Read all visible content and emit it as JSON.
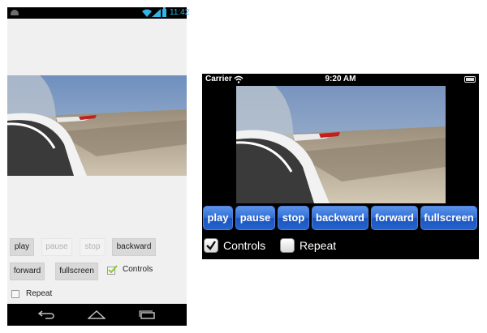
{
  "android": {
    "status_time": "11:42",
    "buttons": {
      "play": "play",
      "pause": "pause",
      "stop": "stop",
      "backward": "backward",
      "forward": "forward",
      "fullscreen": "fullscreen"
    },
    "controls_label": "Controls",
    "controls_checked": true,
    "repeat_label": "Repeat",
    "repeat_checked": false,
    "icons": {
      "status_left": "android-icon",
      "wifi": "wifi-icon",
      "signal": "signal-icon",
      "battery": "battery-icon",
      "nav_back": "back-icon",
      "nav_home": "home-icon",
      "nav_recent": "recent-apps-icon"
    }
  },
  "iphone": {
    "carrier": "Carrier",
    "status_time": "9:20 AM",
    "buttons": {
      "play": "play",
      "pause": "pause",
      "stop": "stop",
      "backward": "backward",
      "forward": "forward",
      "fullscreen": "fullscreen"
    },
    "controls_label": "Controls",
    "controls_checked": true,
    "repeat_label": "Repeat",
    "repeat_checked": false,
    "icons": {
      "wifi": "wifi-icon",
      "battery": "battery-icon"
    }
  },
  "colors": {
    "android_accent": "#33b5e5",
    "android_check": "#8fcf34",
    "ios_button": "#2f6ed8"
  }
}
